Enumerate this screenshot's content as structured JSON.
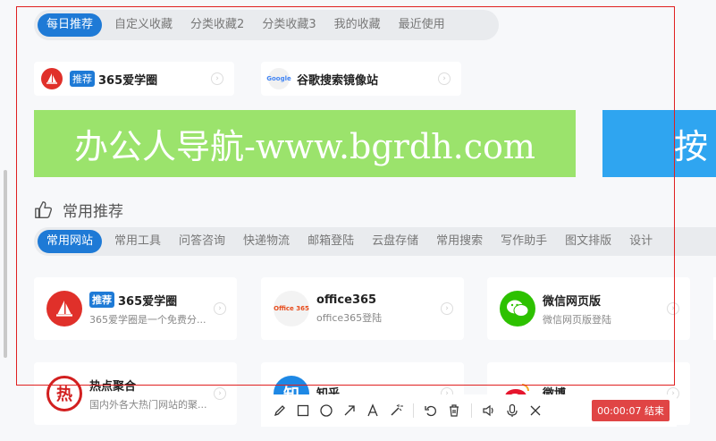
{
  "top_tabs": {
    "items": [
      "每日推荐",
      "自定义收藏",
      "分类收藏2",
      "分类收藏3",
      "我的收藏",
      "最近使用"
    ]
  },
  "fav_cards": [
    {
      "badge": "推荐",
      "title": "365爱学圈"
    },
    {
      "title": "谷歌搜索镜像站",
      "logo_text": "Google"
    }
  ],
  "banners": [
    {
      "text": "办公人导航-www.bgrdh.com",
      "color": "#9be36c"
    },
    {
      "text": "按",
      "color": "#2fa5f0"
    }
  ],
  "section": {
    "title": "常用推荐"
  },
  "category_tabs": {
    "items": [
      "常用网站",
      "常用工具",
      "问答咨询",
      "快递物流",
      "邮箱登陆",
      "云盘存储",
      "常用搜索",
      "写作助手",
      "图文排版",
      "设计"
    ]
  },
  "sites": [
    {
      "badge": "推荐",
      "name": "365爱学圈",
      "desc": "365爱学圈是一个免费分...",
      "logo_color": "#e0302a"
    },
    {
      "name": "office365",
      "desc": "office365登陆",
      "logo_text": "Office 365",
      "logo_color": "#e74c1c"
    },
    {
      "name": "微信网页版",
      "desc": "微信网页版登陆",
      "logo_color": "#2dc100"
    },
    {
      "name": "热点聚合",
      "desc": "国内外各大热门网站的聚...",
      "logo_text": "热",
      "logo_color": "#d21f1f"
    },
    {
      "name": "知乎",
      "desc": "",
      "logo_text": "知",
      "logo_color": "#1e88e5"
    },
    {
      "name": "微博",
      "desc": "",
      "logo_color": "#e6162d"
    }
  ],
  "recorder": {
    "time": "00:00:07 结束"
  },
  "colors": {
    "accent": "#1e7ad6",
    "selection_border": "#e02020",
    "record_button": "#e04545"
  }
}
